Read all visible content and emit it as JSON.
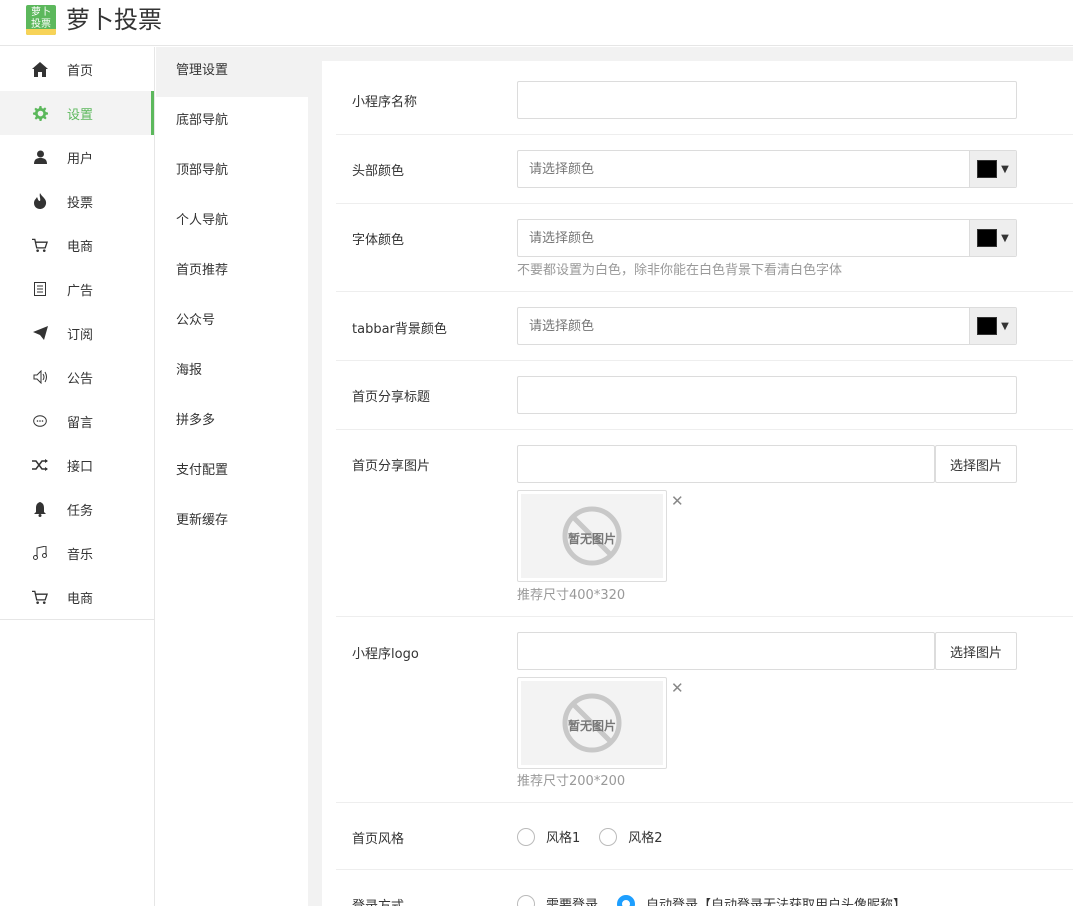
{
  "header": {
    "logo_line1": "萝卜",
    "logo_line2": "投票",
    "app_title": "萝卜投票"
  },
  "sidebar": {
    "items": [
      {
        "label": "首页",
        "icon": "home-icon"
      },
      {
        "label": "设置",
        "icon": "gear-icon"
      },
      {
        "label": "用户",
        "icon": "user-icon"
      },
      {
        "label": "投票",
        "icon": "fire-icon"
      },
      {
        "label": "电商",
        "icon": "cart-icon"
      },
      {
        "label": "广告",
        "icon": "document-icon"
      },
      {
        "label": "订阅",
        "icon": "send-icon"
      },
      {
        "label": "公告",
        "icon": "speaker-icon"
      },
      {
        "label": "留言",
        "icon": "chat-icon"
      },
      {
        "label": "接口",
        "icon": "shuffle-icon"
      },
      {
        "label": "任务",
        "icon": "bell-icon"
      },
      {
        "label": "音乐",
        "icon": "music-icon"
      },
      {
        "label": "电商",
        "icon": "cart-icon"
      }
    ],
    "active_index": 1
  },
  "subnav": {
    "items": [
      "管理设置",
      "底部导航",
      "顶部导航",
      "个人导航",
      "首页推荐",
      "公众号",
      "海报",
      "拼多多",
      "支付配置",
      "更新缓存"
    ],
    "active_index": 0
  },
  "form": {
    "app_name": {
      "label": "小程序名称",
      "value": ""
    },
    "header_color": {
      "label": "头部颜色",
      "placeholder": "请选择颜色",
      "swatch": "#000000"
    },
    "font_color": {
      "label": "字体颜色",
      "placeholder": "请选择颜色",
      "swatch": "#000000",
      "hint": "不要都设置为白色，除非你能在白色背景下看清白色字体"
    },
    "tabbar_color": {
      "label": "tabbar背景颜色",
      "placeholder": "请选择颜色",
      "swatch": "#000000"
    },
    "share_title": {
      "label": "首页分享标题",
      "value": ""
    },
    "share_image": {
      "label": "首页分享图片",
      "button": "选择图片",
      "placeholder_text": "暂无图片",
      "hint": "推荐尺寸400*320"
    },
    "logo": {
      "label": "小程序logo",
      "button": "选择图片",
      "placeholder_text": "暂无图片",
      "hint": "推荐尺寸200*200"
    },
    "style": {
      "label": "首页风格",
      "options": [
        "风格1",
        "风格2"
      ],
      "selected": null
    },
    "login": {
      "label": "登录方式",
      "options": [
        "需要登录",
        "自动登录【自动登录无法获取用户头像昵称】"
      ],
      "selected": 1
    }
  },
  "colors": {
    "accent": "#5cb85c",
    "radio_checked": "#1e9fff"
  }
}
